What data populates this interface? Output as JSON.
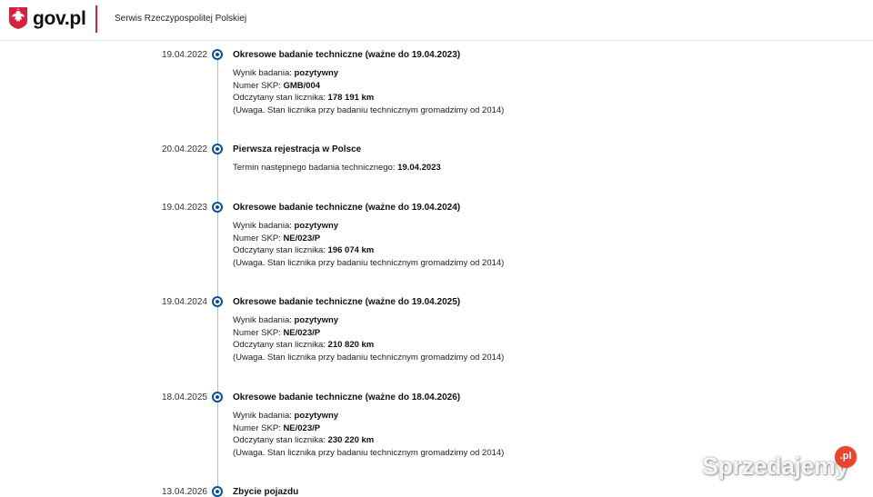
{
  "header": {
    "brand": "gov.pl",
    "service": "Serwis Rzeczypospolitej Polskiej",
    "colors": {
      "accent_divider": "#d4213d",
      "emblem_red": "#d4213d"
    }
  },
  "timeline": {
    "dot_color": "#0052a5",
    "events": [
      {
        "date": "19.04.2022",
        "title": "Okresowe badanie techniczne (ważne do 19.04.2023)",
        "result_label": "Wynik badania:",
        "result": "pozytywny",
        "skp_label": "Numer SKP:",
        "skp": "GMB/004",
        "odometer_label": "Odczytany stan licznika:",
        "odometer": "178 191 km",
        "note": "(Uwaga. Stan licznika przy badaniu technicznym gromadzimy od 2014)"
      },
      {
        "date": "20.04.2022",
        "title": "Pierwsza rejestracja w Polsce",
        "next_label": "Termin następnego badania technicznego:",
        "next": "19.04.2023"
      },
      {
        "date": "19.04.2023",
        "title": "Okresowe badanie techniczne (ważne do 19.04.2024)",
        "result_label": "Wynik badania:",
        "result": "pozytywny",
        "skp_label": "Numer SKP:",
        "skp": "NE/023/P",
        "odometer_label": "Odczytany stan licznika:",
        "odometer": "196 074 km",
        "note": "(Uwaga. Stan licznika przy badaniu technicznym gromadzimy od 2014)"
      },
      {
        "date": "19.04.2024",
        "title": "Okresowe badanie techniczne (ważne do 19.04.2025)",
        "result_label": "Wynik badania:",
        "result": "pozytywny",
        "skp_label": "Numer SKP:",
        "skp": "NE/023/P",
        "odometer_label": "Odczytany stan licznika:",
        "odometer": "210 820 km",
        "note": "(Uwaga. Stan licznika przy badaniu technicznym gromadzimy od 2014)"
      },
      {
        "date": "18.04.2025",
        "title": "Okresowe badanie techniczne (ważne do 18.04.2026)",
        "result_label": "Wynik badania:",
        "result": "pozytywny",
        "skp_label": "Numer SKP:",
        "skp": "NE/023/P",
        "odometer_label": "Odczytany stan licznika:",
        "odometer": "230 220 km",
        "note": "(Uwaga. Stan licznika przy badaniu technicznym gromadzimy od 2014)"
      },
      {
        "date": "13.04.2026",
        "title": "Zbycie pojazdu"
      }
    ]
  },
  "watermark": {
    "text": "Sprzedajemy",
    "badge": ".pl"
  }
}
